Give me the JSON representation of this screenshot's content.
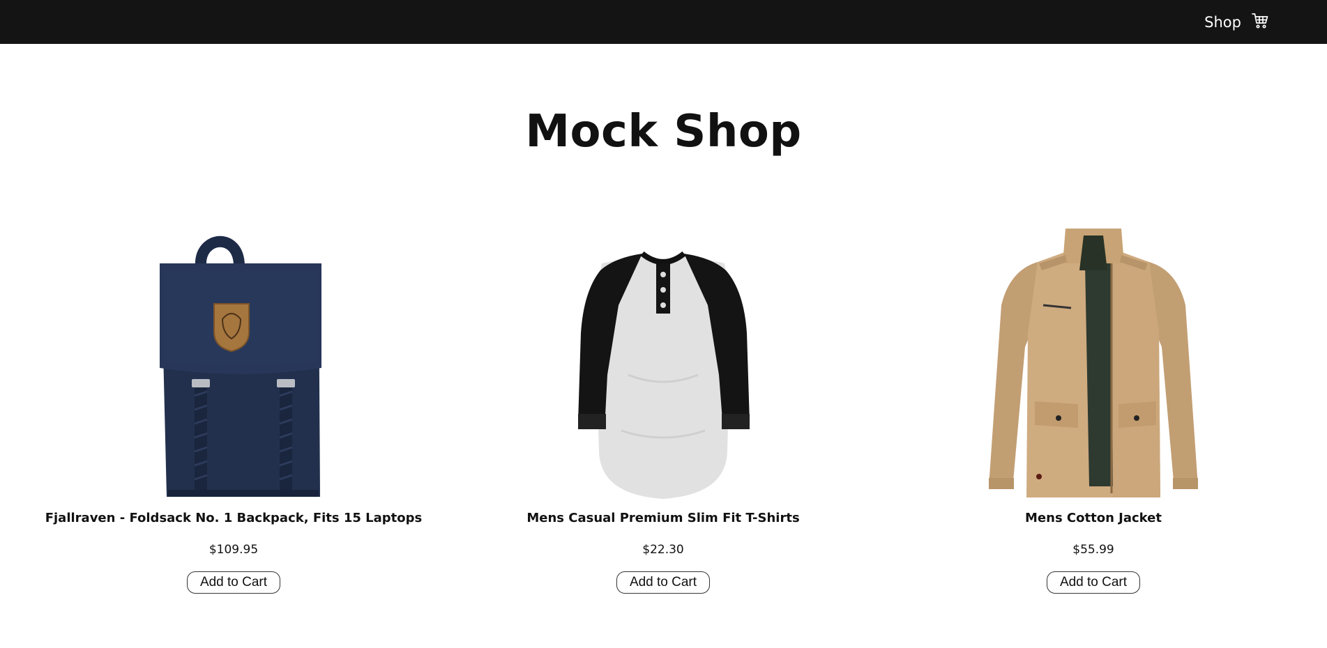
{
  "header": {
    "nav_shop": "Shop",
    "cart_icon": "cart-icon",
    "background": "#141414"
  },
  "page": {
    "title": "Mock Shop"
  },
  "products": [
    {
      "name": "Fjallraven - Foldsack No. 1 Backpack, Fits 15 Laptops",
      "price": "$109.95",
      "button": "Add to Cart",
      "image": "backpack-image",
      "color": "#1f2d4a"
    },
    {
      "name": "Mens Casual Premium Slim Fit T-Shirts",
      "price": "$22.30",
      "button": "Add to Cart",
      "image": "tshirt-image",
      "color": "#dcdcdc"
    },
    {
      "name": "Mens Cotton Jacket",
      "price": "$55.99",
      "button": "Add to Cart",
      "image": "jacket-image",
      "color": "#c9a57b"
    }
  ]
}
